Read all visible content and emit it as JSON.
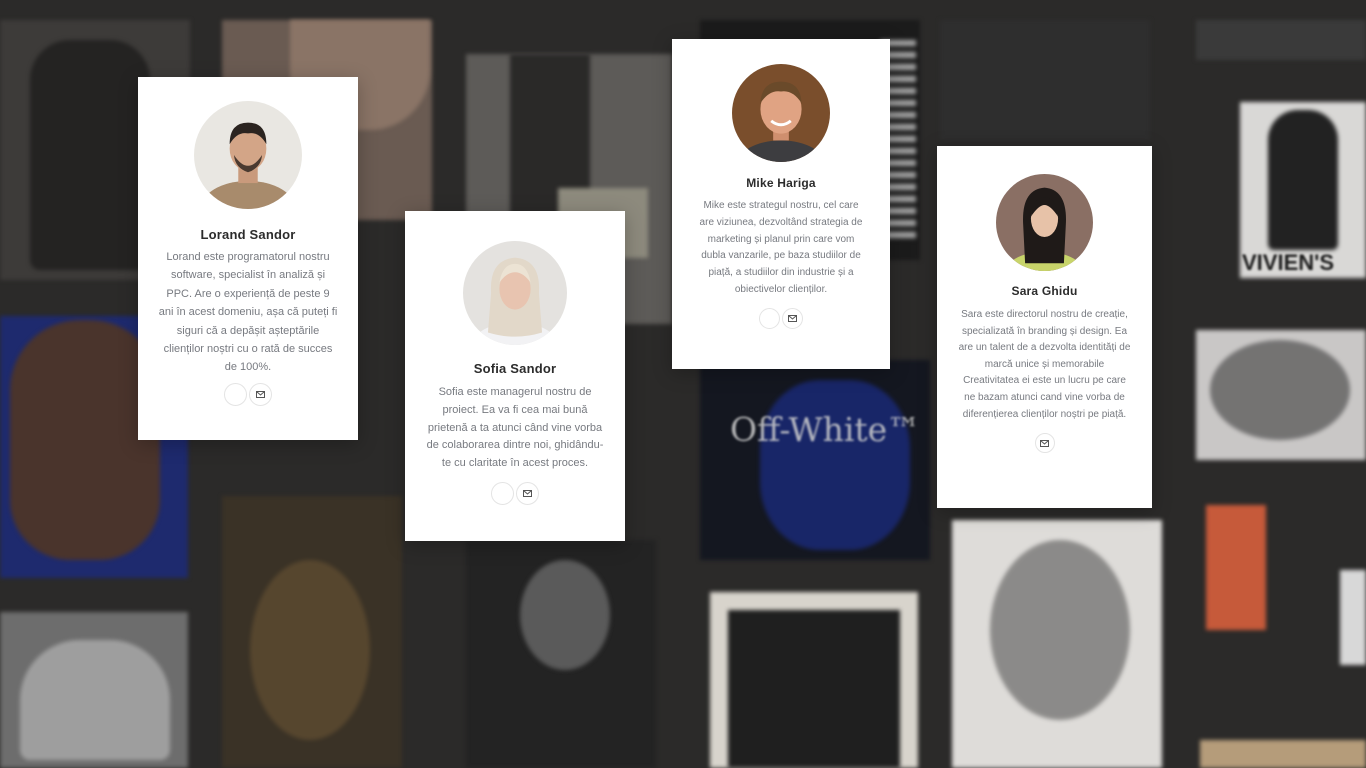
{
  "team": [
    {
      "id": "lorand",
      "name": "Lorand Sandor",
      "bio": "Lorand este programatorul nostru software, specialist în analiză și PPC. Are o experiență de peste 9 ani în acest domeniu, așa că puteți fi siguri că a depășit așteptările clienților noștri cu o rată de succes de 100%.",
      "actions": [
        "social-icon",
        "mail-icon"
      ]
    },
    {
      "id": "sofia",
      "name": "Sofia Sandor",
      "bio": "Sofia este managerul nostru de proiect. Ea va fi cea mai bună prietenă a ta atunci când vine vorba de colaborarea dintre noi, ghidându-te cu claritate în acest proces.",
      "actions": [
        "social-icon",
        "mail-icon"
      ]
    },
    {
      "id": "mike",
      "name": "Mike Hariga",
      "bio": "Mike este strategul nostru, cel care are viziunea, dezvoltând strategia de marketing și planul prin care vom dubla vanzarile, pe baza studiilor de piață, a studiilor din industrie și a obiectivelor clienților.",
      "actions": [
        "social-icon",
        "mail-icon"
      ]
    },
    {
      "id": "sara",
      "name": "Sara Ghidu",
      "bio": "Sara este directorul nostru de creație, specializată în branding și design. Ea are un talent de a dezvolta identități de marcă unice și memorabile Creativitatea ei este un lucru pe care ne bazam atunci cand vine vorba de diferențierea clienților noștri pe piață.",
      "actions": [
        "mail-icon"
      ]
    }
  ],
  "background": {
    "texts": [
      "Off-White™",
      "VIVIEN'S"
    ]
  },
  "colors": {
    "card_bg": "#ffffff",
    "name": "#2c2c2c",
    "bio": "#777a80",
    "icon_border": "#e4e4e4"
  }
}
